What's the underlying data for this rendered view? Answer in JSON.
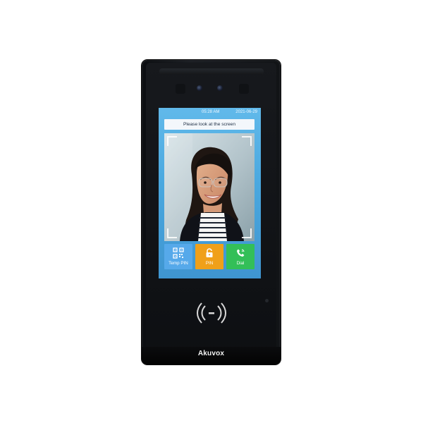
{
  "device": {
    "brand": "Akuvox"
  },
  "screen": {
    "status": {
      "time": "05:28",
      "meridiem": "AM",
      "date": "2021-06-29"
    },
    "prompt": "Please look at the screen",
    "actions": [
      {
        "label": "Temp PIN",
        "icon": "qr-code-icon",
        "color": "#56a9ea"
      },
      {
        "label": "PIN",
        "icon": "lock-icon",
        "color": "#f0a019"
      },
      {
        "label": "Dial",
        "icon": "phone-icon",
        "color": "#33bf58"
      }
    ]
  },
  "colors": {
    "screen_blue": "#4aa8df",
    "device_black": "#111316"
  },
  "icons": {
    "reader": "contactless-icon"
  }
}
